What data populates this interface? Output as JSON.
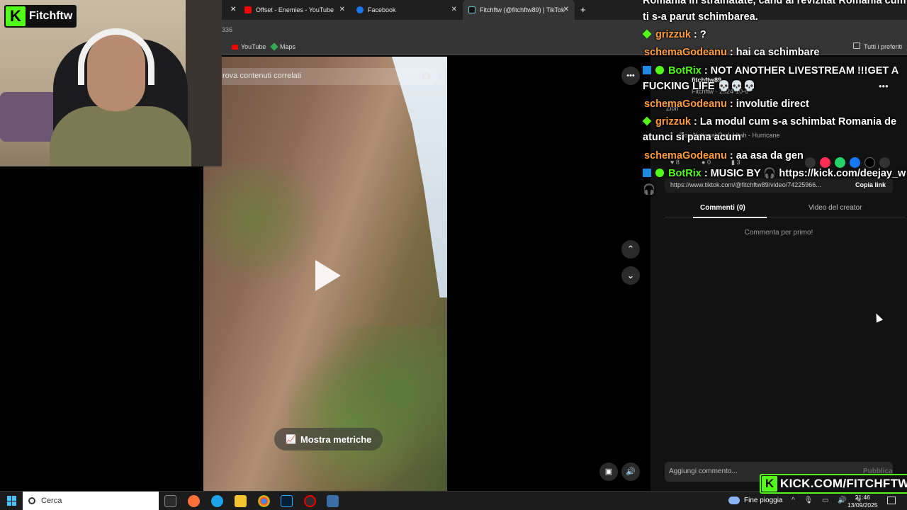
{
  "webcam": {
    "streamer_name": "Fitchftw"
  },
  "browser": {
    "tabs": [
      {
        "title": "Offset - Enemies - YouTube",
        "favicon_color": "#ff0000",
        "active": false
      },
      {
        "title": "Facebook",
        "favicon_color": "#1877f2",
        "active": false
      },
      {
        "title": "Fitchftw (@fitchftw89) | TikTok",
        "favicon_color": "#111111",
        "active": true
      }
    ],
    "address_fragment": "336",
    "bookmarks": [
      "YouTube",
      "Maps"
    ],
    "all_bookmarks": "Tutti i preferiti"
  },
  "video": {
    "search_placeholder": "rova contenuti correlati",
    "metrics_button": "Mostra metriche"
  },
  "panel": {
    "author": "fitchftw89",
    "author_meta": "Fitchftw · 2024-10-6",
    "location": "Zion",
    "music": "Zion National Park Utah - Hurricane",
    "stats": [
      "8",
      "0",
      "3"
    ],
    "link": "https://www.tiktok.com/@fitchftw89/video/74225966...",
    "copy_link": "Copia link",
    "tab_comments": "Commenti (0)",
    "tab_creator": "Video del creator",
    "empty_comments": "Commenta per primo!",
    "comment_placeholder": "Aggiungi commento...",
    "publish": "Pubblica"
  },
  "chat": [
    {
      "user": "",
      "text": "Romania in strainatate, cand ai revizitat Romania cum",
      "color": "#ffffff"
    },
    {
      "user": "",
      "text": "ti s-a parut schimbarea.",
      "color": "#ffffff"
    },
    {
      "user": "grizzuk",
      "text": ": ?",
      "color": "#ff9b3d",
      "icon": "green-diamond-icon"
    },
    {
      "user": "schemaGodeanu",
      "text": ": hai ca schimbare",
      "color": "#ff9b3d"
    },
    {
      "user": "BotRix",
      "text": ": NOT ANOTHER LIVESTREAM !!!GET A",
      "color": "#53fc18",
      "icon": "bot-badge-icon"
    },
    {
      "user": "",
      "text": "FUCKING LIFE 💀💀💀",
      "color": "#ffffff"
    },
    {
      "user": "schemaGodeanu",
      "text": ": involutie direct",
      "color": "#ff9b3d"
    },
    {
      "user": "grizzuk",
      "text": ": La modul cum s-a schimbat Romania de",
      "color": "#ff9b3d",
      "icon": "green-diamond-icon"
    },
    {
      "user": "",
      "text": "atunci si pana acum",
      "color": "#ffffff"
    },
    {
      "user": "schemaGodeanu",
      "text": ": aa asa da gen",
      "color": "#ff9b3d"
    },
    {
      "user": "BotRix",
      "text": ": MUSIC BY 🎧 https://kick.com/deejay_w",
      "color": "#53fc18",
      "icon": "bot-badge-icon"
    },
    {
      "user": "",
      "text": "🎧",
      "color": "#ffffff"
    }
  ],
  "taskbar": {
    "search_label": "Cerca",
    "weather": "Fine pioggia",
    "time": "21:46",
    "date": "13/09/2025"
  },
  "watermark": {
    "text": "KICK.COM/FITCHFTW"
  },
  "colors": {
    "kick_green": "#53fc18",
    "tiktok_bg": "#121212"
  }
}
